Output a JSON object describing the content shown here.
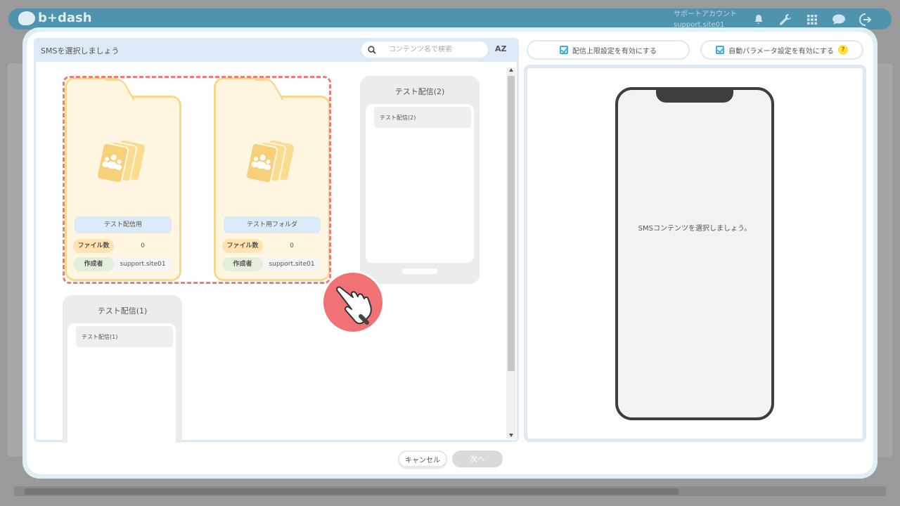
{
  "app": {
    "logo_text": "b+dash",
    "account_label": "サポートアカウント",
    "account_id": "support.site01",
    "icons": [
      "bell-icon",
      "wrench-icon",
      "grid-icon",
      "chat-icon",
      "logout-icon"
    ]
  },
  "dialog": {
    "title": "SMSを選択しましょう",
    "search_placeholder": "コンテンツ名で検索",
    "sort_label": "AZ",
    "options": {
      "limit_label": "配信上限設定を有効にする",
      "auto_param_label": "自動パラメータ設定を有効にする",
      "help_glyph": "?"
    },
    "folders": [
      {
        "name": "テスト配信用",
        "file_count_label": "ファイル数",
        "file_count": "0",
        "author_label": "作成者",
        "author": "support.site01"
      },
      {
        "name": "テスト用フォルダ",
        "file_count_label": "ファイル数",
        "file_count": "0",
        "author_label": "作成者",
        "author": "support.site01"
      }
    ],
    "contents": [
      {
        "title": "テスト配信(2)",
        "message": "テスト配信(2)"
      },
      {
        "title": "テスト配信(1)",
        "message": "テスト配信(1)"
      }
    ],
    "preview_message": "SMSコンテンツを選択しましょう。",
    "buttons": {
      "cancel": "キャンセル",
      "next": "次へ"
    }
  },
  "colors": {
    "topbar": "#4f93ad",
    "panel_header": "#dbeaf6",
    "folder_bg": "#fff6e1",
    "folder_border": "#f7d98d",
    "selection": "#f07a7c",
    "checkbox": "#3ab0e1"
  }
}
